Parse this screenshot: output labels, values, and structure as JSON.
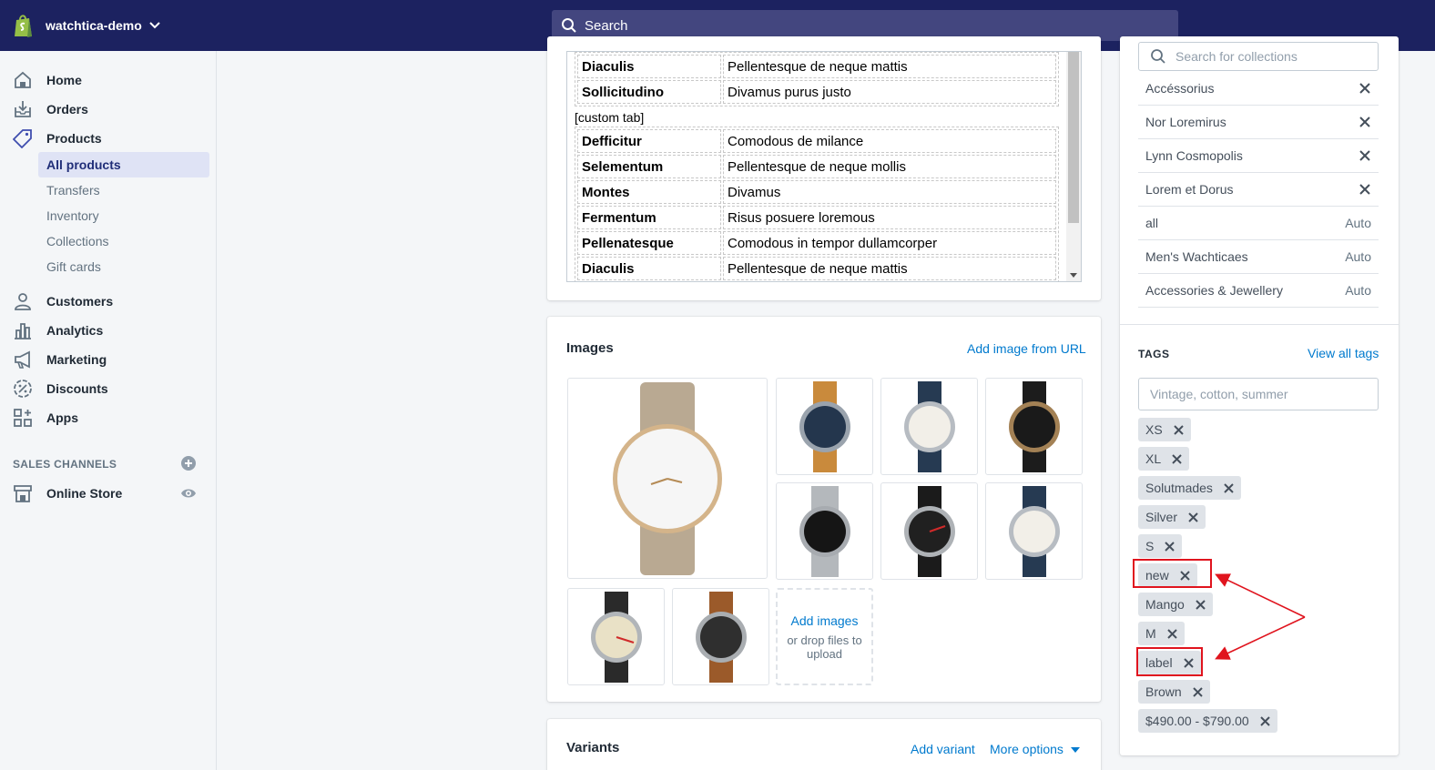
{
  "topbar": {
    "store_name": "watchtica-demo",
    "search_placeholder": "Search"
  },
  "sidebar": {
    "items": [
      {
        "label": "Home",
        "icon": "home-icon"
      },
      {
        "label": "Orders",
        "icon": "orders-icon"
      },
      {
        "label": "Products",
        "icon": "tag-icon"
      },
      {
        "label": "Customers",
        "icon": "person-icon"
      },
      {
        "label": "Analytics",
        "icon": "bar-chart-icon"
      },
      {
        "label": "Marketing",
        "icon": "megaphone-icon"
      },
      {
        "label": "Discounts",
        "icon": "discount-icon"
      },
      {
        "label": "Apps",
        "icon": "apps-icon"
      }
    ],
    "product_sub_items": [
      "All products",
      "Transfers",
      "Inventory",
      "Collections",
      "Gift cards"
    ],
    "active_sub_item": "All products",
    "sales_channels_label": "SALES CHANNELS",
    "online_store_label": "Online Store"
  },
  "spec_table": {
    "top_rows": [
      {
        "key": "Diaculis",
        "value": "Pellentesque de neque mattis"
      },
      {
        "key": "Sollicitudino",
        "value": "Divamus purus justo"
      }
    ],
    "custom_tab_label": "[custom tab]",
    "bottom_rows": [
      {
        "key": "Defficitur",
        "value": "Comodous de milance"
      },
      {
        "key": "Selementum",
        "value": "Pellentesque de neque mollis"
      },
      {
        "key": "Montes",
        "value": "Divamus"
      },
      {
        "key": "Fermentum",
        "value": "Risus posuere loremous"
      },
      {
        "key": "Pellenatesque",
        "value": "Comodous in tempor dullamcorper"
      },
      {
        "key": "Diaculis",
        "value": "Pellentesque de neque mattis"
      }
    ]
  },
  "images": {
    "title": "Images",
    "add_from_url": "Add image from URL",
    "dropzone_add": "Add images",
    "dropzone_hint": "or drop files to upload"
  },
  "variants": {
    "title": "Variants",
    "add_variant": "Add variant",
    "more_options": "More options"
  },
  "collections": {
    "search_placeholder": "Search for collections",
    "items": [
      {
        "name": "Accéssorius",
        "type": "remove"
      },
      {
        "name": "Nor Loremirus",
        "type": "remove"
      },
      {
        "name": "Lynn Cosmopolis",
        "type": "remove"
      },
      {
        "name": "Lorem et Dorus",
        "type": "remove"
      },
      {
        "name": "all",
        "type": "Auto"
      },
      {
        "name": "Men's Wachticaes",
        "type": "Auto"
      },
      {
        "name": "Accessories & Jewellery",
        "type": "Auto"
      }
    ]
  },
  "tags": {
    "title": "TAGS",
    "view_all": "View all tags",
    "input_placeholder": "Vintage, cotton, summer",
    "items": [
      "XS",
      "XL",
      "Solutmades",
      "Silver",
      "S",
      "new",
      "Mango",
      "M",
      "label",
      "Brown",
      "$490.00 - $790.00"
    ],
    "highlighted": [
      "new",
      "label"
    ]
  },
  "colors": {
    "topbar": "#1c2260",
    "link": "#007ace",
    "highlight": "#e0141e"
  }
}
